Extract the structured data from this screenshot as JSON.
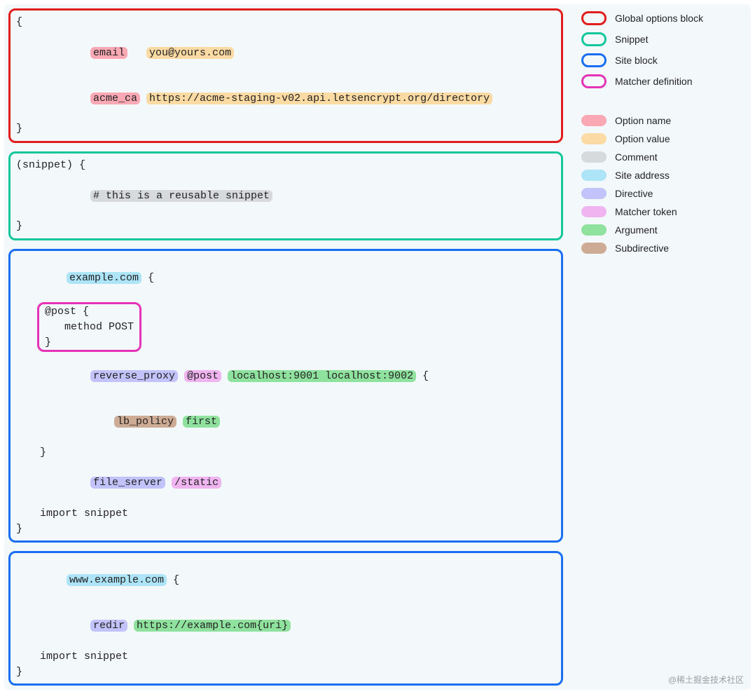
{
  "global_block": {
    "open": "{",
    "close": "}",
    "opt1_name": "email",
    "opt1_gap": "   ",
    "opt1_value": "you@yours.com",
    "opt2_name": "acme_ca",
    "opt2_gap": " ",
    "opt2_value": "https://acme-staging-v02.api.letsencrypt.org/directory"
  },
  "snippet_block": {
    "header": "(snippet) {",
    "comment": "# this is a reusable snippet",
    "close": "}"
  },
  "site1": {
    "addr": "example.com",
    "open_tail": " {",
    "matcher_def": {
      "header": "@post {",
      "body": "method POST",
      "close": "}"
    },
    "rp_directive": "reverse_proxy",
    "rp_matcher": "@post",
    "rp_args": "localhost:9001 localhost:9002",
    "rp_tail": " {",
    "sub_directive": "lb_policy",
    "sub_arg": "first",
    "rp_close": "}",
    "fs_directive": "file_server",
    "fs_matcher": "/static",
    "import_line": "import snippet",
    "close": "}"
  },
  "site2": {
    "addr": "www.example.com",
    "open_tail": " {",
    "redir_directive": "redir",
    "redir_arg": "https://example.com{uri}",
    "import_line": "import snippet",
    "close": "}"
  },
  "legend_blocks": {
    "global": "Global options block",
    "snippet": "Snippet",
    "site": "Site block",
    "matcher": "Matcher definition"
  },
  "legend_tokens": {
    "option_name": "Option name",
    "option_value": "Option value",
    "comment": "Comment",
    "site_addr": "Site address",
    "directive": "Directive",
    "matcher": "Matcher token",
    "argument": "Argument",
    "subdirective": "Subdirective"
  },
  "watermark": "@稀土掘金技术社区"
}
